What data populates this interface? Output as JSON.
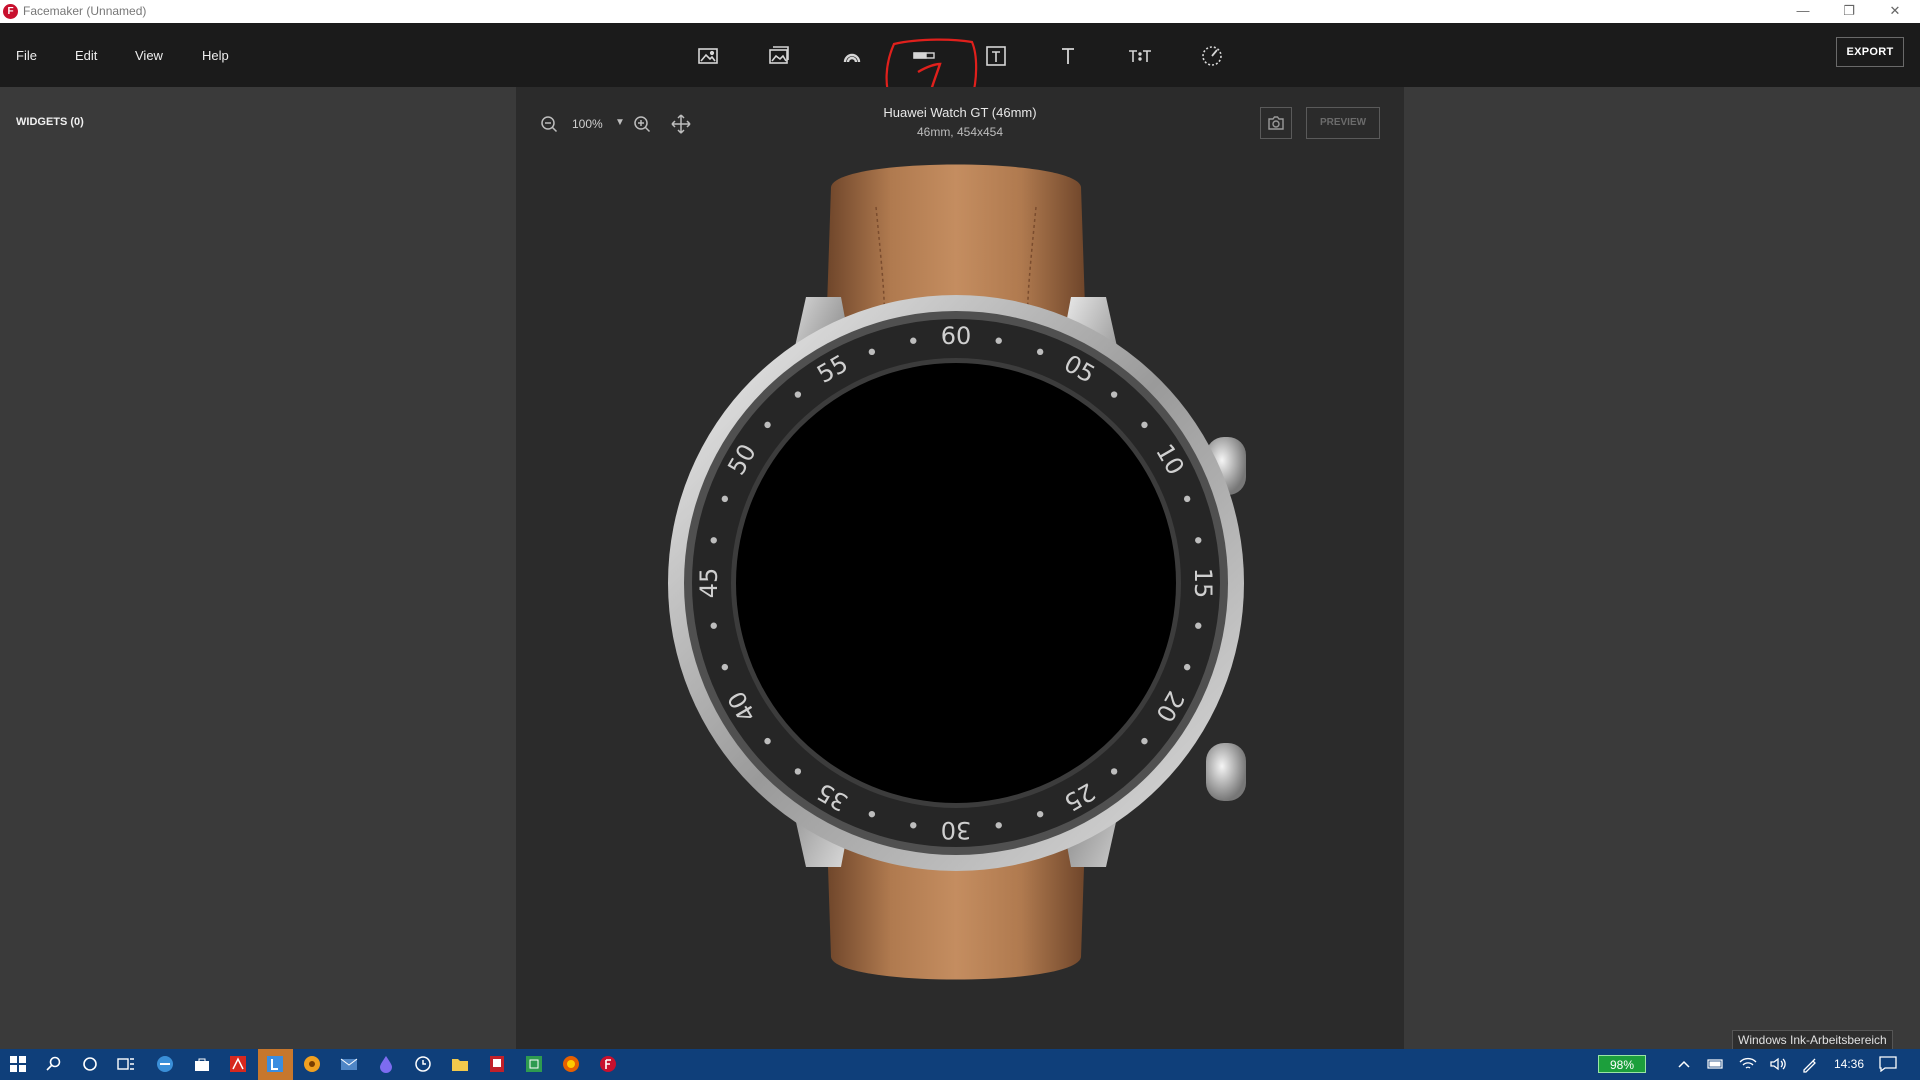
{
  "window": {
    "app_icon_letter": "F",
    "title": "Facemaker (Unnamed)"
  },
  "menu": {
    "items": [
      "File",
      "Edit",
      "View",
      "Help"
    ]
  },
  "toolbar": {
    "tools": [
      "image-icon",
      "image-gallery-icon",
      "shape-icon",
      "progress-bar-icon",
      "text-box-icon",
      "text-icon",
      "formatted-text-icon",
      "gauge-icon"
    ],
    "export_label": "EXPORT"
  },
  "left_panel": {
    "widgets_label": "WIDGETS (0)"
  },
  "canvas": {
    "zoom_value": "100%",
    "device_name": "Huawei Watch GT (46mm)",
    "device_spec": "46mm, 454x454",
    "preview_label": "PREVIEW",
    "bezel_numbers": [
      "60",
      "05",
      "10",
      "15",
      "20",
      "25",
      "30",
      "35",
      "40",
      "45",
      "50",
      "55"
    ]
  },
  "taskbar": {
    "tooltip": "Windows Ink-Arbeitsbereich",
    "battery": "98%",
    "time": "14:36"
  },
  "colors": {
    "annotation": "#e0201c",
    "strap": "#a8724a",
    "taskbar": "#0f3f7a"
  }
}
